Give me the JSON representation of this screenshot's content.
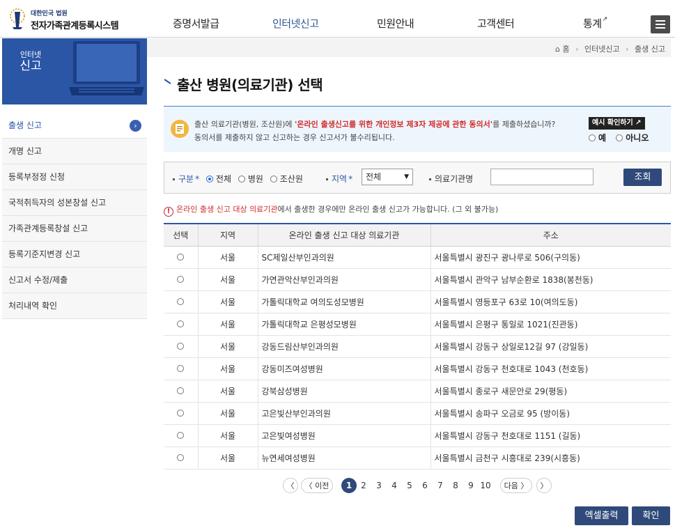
{
  "header": {
    "logo_sub": "대한민국 법원",
    "logo_main": "전자가족관계등록시스템",
    "nav": [
      {
        "label": "증명서발급"
      },
      {
        "label": "인터넷신고"
      },
      {
        "label": "민원안내"
      },
      {
        "label": "고객센터"
      },
      {
        "label": "통계"
      }
    ],
    "menu_icon": "hamburger-icon"
  },
  "sidebar": {
    "banner_line1": "인터넷",
    "banner_line2": "신고",
    "items": [
      {
        "label": "출생 신고"
      },
      {
        "label": "개명 신고"
      },
      {
        "label": "등록부정정 신청"
      },
      {
        "label": "국적취득자의 성본창설 신고"
      },
      {
        "label": "가족관계등록창설 신고"
      },
      {
        "label": "등록기준지변경 신고"
      },
      {
        "label": "신고서 수정/제출"
      },
      {
        "label": "처리내역 확인"
      }
    ]
  },
  "breadcrumb": {
    "home": "홈",
    "level1": "인터넷신고",
    "level2": "출생 신고"
  },
  "page_title": "출산 병원(의료기관) 선택",
  "notice": {
    "line1_pre": "출산 의료기관(병원, 조산원)에 ",
    "line1_highlight": "'온라인 출생신고를 위한 개인정보 제3자 제공에 관한 동의서'",
    "line1_post": "를 제출하셨습니까?",
    "line2": "동의서를 제출하지 않고 신고하는 경우 신고서가 불수리됩니다.",
    "example_button": "예시 확인하기",
    "yes": "예",
    "no": "아니오"
  },
  "search": {
    "type_label": "구분",
    "type_options": [
      "전체",
      "병원",
      "조산원"
    ],
    "region_label": "지역",
    "region_value": "전체",
    "institution_label": "의료기관명",
    "institution_value": "",
    "search_button": "조회",
    "required_mark": "*"
  },
  "warning": {
    "icon": "!",
    "highlight": "온라인 출생 신고 대상 의료기관",
    "text": "에서 출생한 경우에만 온라인 출생 신고가 가능합니다. (그 외 불가능)"
  },
  "table": {
    "headers": [
      "선택",
      "지역",
      "온라인 출생 신고 대상 의료기관",
      "주소"
    ],
    "rows": [
      {
        "region": "서울",
        "name": "SC제일산부인과의원",
        "address": "서울특별시 광진구 광나루로 506(구의동)"
      },
      {
        "region": "서울",
        "name": "가연관악산부인과의원",
        "address": "서울특별시 관악구 남부순환로 1838(봉천동)"
      },
      {
        "region": "서울",
        "name": "가톨릭대학교 여의도성모병원",
        "address": "서울특별시 영등포구 63로 10(여의도동)"
      },
      {
        "region": "서울",
        "name": "가톨릭대학교 은평성모병원",
        "address": "서울특별시 은평구 통일로 1021(진관동)"
      },
      {
        "region": "서울",
        "name": "강동드림산부인과의원",
        "address": "서울특별시 강동구 상일로12길 97 (강일동)"
      },
      {
        "region": "서울",
        "name": "강동미즈여성병원",
        "address": "서울특별시 강동구 천호대로 1043 (천호동)"
      },
      {
        "region": "서울",
        "name": "강북삼성병원",
        "address": "서울특별시 종로구 새문안로 29(평동)"
      },
      {
        "region": "서울",
        "name": "고은빛산부인과의원",
        "address": "서울특별시 송파구 오금로 95 (방이동)"
      },
      {
        "region": "서울",
        "name": "고은빛여성병원",
        "address": "서울특별시 강동구 천호대로 1151 (길동)"
      },
      {
        "region": "서울",
        "name": "뉴연세여성병원",
        "address": "서울특별시 금천구 시흥대로 239(시흥동)"
      }
    ]
  },
  "pagination": {
    "first": "〈",
    "prev": "〈 이전",
    "pages": [
      "1",
      "2",
      "3",
      "4",
      "5",
      "6",
      "7",
      "8",
      "9",
      "10"
    ],
    "current": "1",
    "next": "다음 〉",
    "last": "〉"
  },
  "buttons": {
    "excel": "엑셀출력",
    "confirm": "확인"
  }
}
